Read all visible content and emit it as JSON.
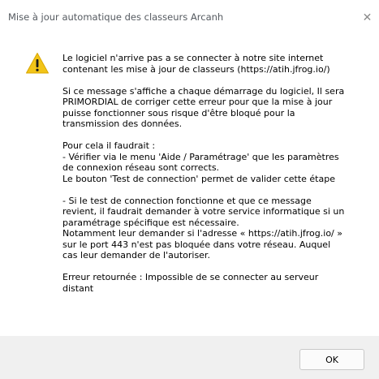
{
  "window": {
    "title": "Mise à jour automatique des classeurs Arcanh",
    "close_icon": "close-icon"
  },
  "message": {
    "icon": "warning-icon",
    "text": "Le logiciel n'arrive pas a se connecter à notre site internet\ncontenant les mise à jour de classeurs (https://atih.jfrog.io/)\n\nSi ce message s'affiche a chaque démarrage du logiciel, Il sera\nPRIMORDIAL de corriger cette erreur pour que la mise à jour\npuisse fonctionner sous risque d'être bloqué pour la\ntransmission des données.\n\nPour cela il faudrait :\n - Vérifier via le menu 'Aide / Paramétrage' que les paramètres\nde connexion réseau sont corrects.\nLe bouton 'Test de connection' permet de valider cette étape\n\n - Si le test de connection fonctionne et que ce message\nrevient, il faudrait demander à votre service informatique si un\nparamétrage spécifique est nécessaire.\nNotamment leur demander si l'adresse « https://atih.jfrog.io/ »\nsur le port 443 n'est pas bloquée dans votre réseau. Auquel\ncas leur demander de l'autoriser.\n\nErreur retournée : Impossible de se connecter au serveur\ndistant"
  },
  "buttons": {
    "ok_label": "OK"
  }
}
